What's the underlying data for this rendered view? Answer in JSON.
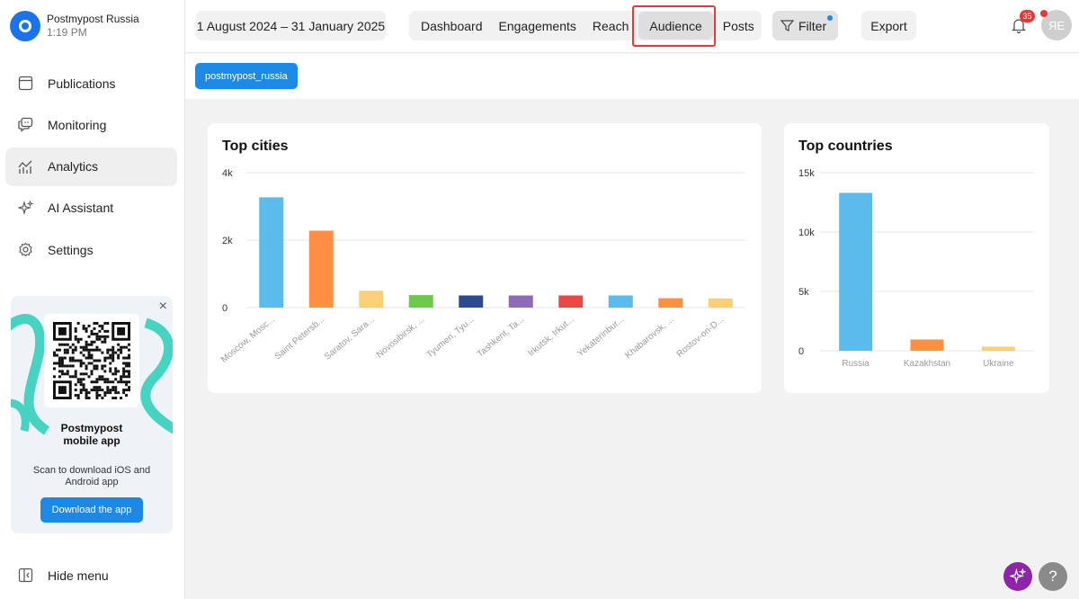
{
  "account": {
    "name": "Postmypost Russia",
    "time": "1:19 PM"
  },
  "nav": [
    {
      "label": "Publications",
      "icon": "calendar-icon",
      "active": false
    },
    {
      "label": "Monitoring",
      "icon": "chat-monitor-icon",
      "active": false
    },
    {
      "label": "Analytics",
      "icon": "analytics-icon",
      "active": true
    },
    {
      "label": "AI Assistant",
      "icon": "sparkle-icon",
      "active": false
    },
    {
      "label": "Settings",
      "icon": "gear-icon",
      "active": false
    }
  ],
  "promo": {
    "title": "Postmypost mobile app",
    "subtitle": "Scan to download iOS and Android app",
    "button": "Download the app",
    "close": "×"
  },
  "hide_menu": "Hide menu",
  "topbar": {
    "date_range": "1 August 2024 – 31 January 2025",
    "tabs": [
      "Dashboard",
      "Engagements",
      "Reach",
      "Audience",
      "Posts"
    ],
    "active_tab": "Audience",
    "filter": "Filter",
    "export": "Export",
    "notifications": "35",
    "avatar": "ЯЕ"
  },
  "account_chip": "postmypost_russia",
  "colors": {
    "accent": "#1e88e5",
    "bar_colors": [
      "#5bbbea",
      "#ff8f45",
      "#f9cf78",
      "#6cc84f",
      "#2e4a8f",
      "#8e6bb8",
      "#ef4545",
      "#5bbbea",
      "#ff8f45",
      "#f9cf78"
    ]
  },
  "chart_data": [
    {
      "type": "bar",
      "title": "Top cities",
      "categories": [
        "Moscow, Mosc...",
        "Saint Petersb...",
        "Saratov, Sara...",
        "Novosibirsk, ...",
        "Tyumen, Tyu...",
        "Tashkent, Ta...",
        "Irkutsk, Irkut...",
        "Yekaterinbur...",
        "Khabarovsk, ...",
        "Rostov-on-D..."
      ],
      "values": [
        3270,
        2280,
        500,
        370,
        360,
        360,
        360,
        360,
        280,
        270
      ],
      "yticks": [
        "0",
        "2k",
        "4k"
      ],
      "ylim": [
        0,
        4000
      ],
      "grid": true
    },
    {
      "type": "bar",
      "title": "Top countries",
      "categories": [
        "Russia",
        "Kazakhstan",
        "Ukraine"
      ],
      "values": [
        13300,
        950,
        350
      ],
      "yticks": [
        "0",
        "5k",
        "10k",
        "15k"
      ],
      "ylim": [
        0,
        15000
      ],
      "grid": true
    }
  ]
}
